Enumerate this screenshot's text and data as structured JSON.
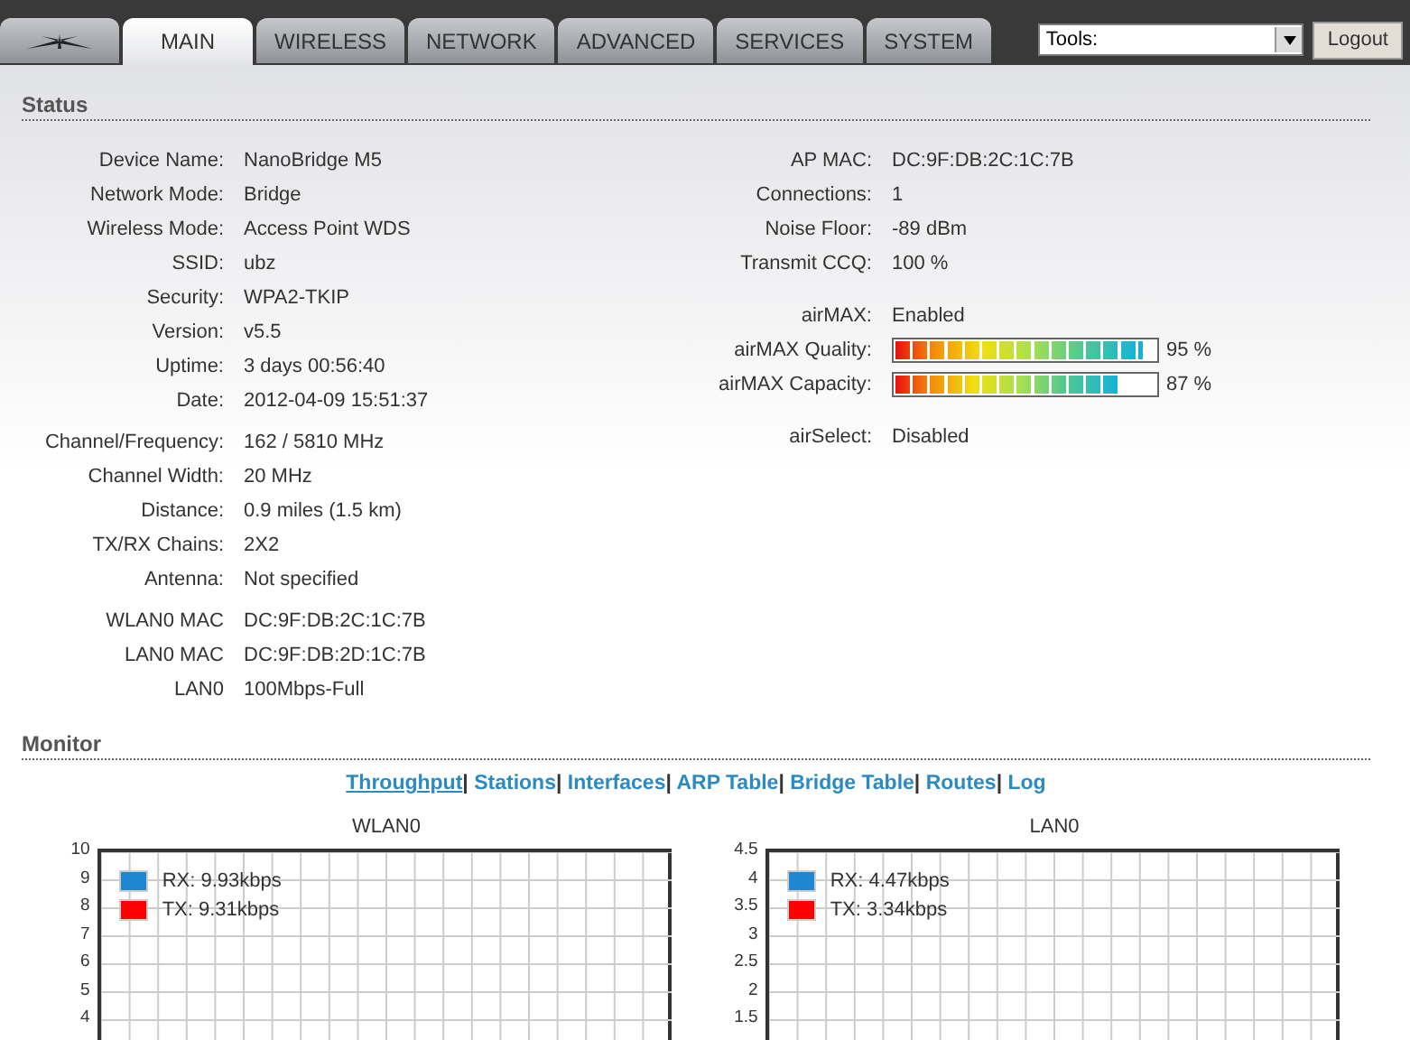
{
  "tabs": [
    {
      "label": "MAIN",
      "selected": true
    },
    {
      "label": "WIRELESS",
      "selected": false
    },
    {
      "label": "NETWORK",
      "selected": false
    },
    {
      "label": "ADVANCED",
      "selected": false
    },
    {
      "label": "SERVICES",
      "selected": false
    },
    {
      "label": "SYSTEM",
      "selected": false
    }
  ],
  "tools": {
    "value": "Tools:"
  },
  "logout": "Logout",
  "status": {
    "title": "Status",
    "left": [
      [
        {
          "label": "Device Name:",
          "value": "NanoBridge M5"
        },
        {
          "label": "Network Mode:",
          "value": "Bridge"
        },
        {
          "label": "Wireless Mode:",
          "value": "Access Point WDS"
        },
        {
          "label": "SSID:",
          "value": "ubz"
        },
        {
          "label": "Security:",
          "value": "WPA2-TKIP"
        },
        {
          "label": "Version:",
          "value": "v5.5"
        },
        {
          "label": "Uptime:",
          "value": "3 days 00:56:40"
        },
        {
          "label": "Date:",
          "value": "2012-04-09 15:51:37"
        }
      ],
      [
        {
          "label": "Channel/Frequency:",
          "value": "162 / 5810 MHz"
        },
        {
          "label": "Channel Width:",
          "value": "20 MHz"
        },
        {
          "label": "Distance:",
          "value": "0.9 miles (1.5 km)"
        },
        {
          "label": "TX/RX Chains:",
          "value": "2X2"
        },
        {
          "label": "Antenna:",
          "value": "Not specified"
        }
      ],
      [
        {
          "label": "WLAN0 MAC",
          "value": "DC:9F:DB:2C:1C:7B"
        },
        {
          "label": "LAN0 MAC",
          "value": "DC:9F:DB:2D:1C:7B"
        },
        {
          "label": "LAN0",
          "value": "100Mbps-Full"
        }
      ]
    ],
    "right": [
      [
        {
          "kind": "text",
          "label": "AP MAC:",
          "value": "DC:9F:DB:2C:1C:7B"
        },
        {
          "kind": "text",
          "label": "Connections:",
          "value": "1"
        },
        {
          "kind": "text",
          "label": "Noise Floor:",
          "value": "-89 dBm"
        },
        {
          "kind": "text",
          "label": "Transmit CCQ:",
          "value": "100 %"
        }
      ],
      [
        {
          "kind": "text",
          "label": "airMAX:",
          "value": "Enabled"
        },
        {
          "kind": "meter",
          "label": "airMAX Quality:",
          "level": 0.95,
          "reading": "95 %"
        },
        {
          "kind": "meter",
          "label": "airMAX Capacity:",
          "level": 0.87,
          "reading": "87 %"
        }
      ],
      [
        {
          "kind": "text",
          "label": "airSelect:",
          "value": "Disabled"
        }
      ]
    ]
  },
  "monitor": {
    "title": "Monitor",
    "separator": "|",
    "links": [
      {
        "label": "Throughput",
        "selected": true
      },
      {
        "label": "Stations",
        "selected": false
      },
      {
        "label": "Interfaces",
        "selected": false
      },
      {
        "label": "ARP Table",
        "selected": false
      },
      {
        "label": "Bridge Table",
        "selected": false
      },
      {
        "label": "Routes",
        "selected": false
      },
      {
        "label": "Log",
        "selected": false
      }
    ],
    "charts": [
      {
        "title": "WLAN0",
        "yticks": [
          "10",
          "9",
          "8",
          "7",
          "6",
          "5",
          "4"
        ],
        "legend": [
          {
            "label": "RX: 9.93kbps",
            "color": "#1f87d0"
          },
          {
            "label": "TX: 9.31kbps",
            "color": "#ff0000"
          }
        ]
      },
      {
        "title": "LAN0",
        "yticks": [
          "4.5",
          "4",
          "3.5",
          "3",
          "2.5",
          "2",
          "1.5"
        ],
        "legend": [
          {
            "label": "RX: 4.47kbps",
            "color": "#1f87d0"
          },
          {
            "label": "TX: 3.34kbps",
            "color": "#ff0000"
          }
        ]
      }
    ]
  }
}
